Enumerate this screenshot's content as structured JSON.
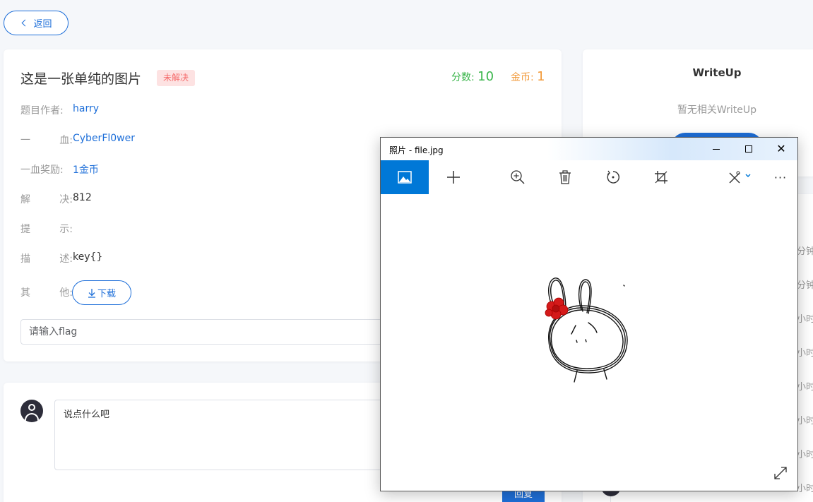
{
  "nav": {
    "back_label": "返回"
  },
  "challenge": {
    "title": "这是一张单纯的图片",
    "status": "未解决",
    "score_label": "分数:",
    "score_value": "10",
    "coin_label": "金币:",
    "coin_value": "1",
    "fields": [
      {
        "label_chars": [
          "题目作者:"
        ],
        "value": "harry"
      },
      {
        "label_chars": [
          "一",
          "血:"
        ],
        "value": "CyberFl0wer"
      },
      {
        "label_chars": [
          "一血奖励:"
        ],
        "value": "1金币"
      },
      {
        "label_chars": [
          "解",
          "决:"
        ],
        "value": "812"
      },
      {
        "label_chars": [
          "提",
          "示:"
        ],
        "value": ""
      },
      {
        "label_chars": [
          "描",
          "述:"
        ],
        "value": "key{}"
      },
      {
        "label_chars": [
          "其",
          "他:"
        ],
        "value": ""
      }
    ],
    "download_label": "下载",
    "flag_placeholder": "请输入flag"
  },
  "comment": {
    "placeholder": "说点什么吧",
    "reply_label": "回复"
  },
  "writeup": {
    "title": "WriteUp",
    "empty_text": "暂无相关WriteUp"
  },
  "sidebar_times": [
    "分钟",
    "分钟",
    "小时",
    "小时",
    "小时",
    "小时",
    "小时",
    "小时"
  ],
  "photos_window": {
    "title": "照片 - file.jpg",
    "toolbar": [
      "image-icon",
      "add-icon",
      "zoom-in-icon",
      "delete-icon",
      "rotate-icon",
      "crop-icon",
      "edit-draw-icon",
      "more-icon"
    ],
    "more_label": "···"
  },
  "colors": {
    "primary": "#1e6fd9",
    "score": "#39b54a",
    "coin": "#f29a3a",
    "unsolved": "#f56c6c",
    "photos_accent": "#0078d7"
  }
}
